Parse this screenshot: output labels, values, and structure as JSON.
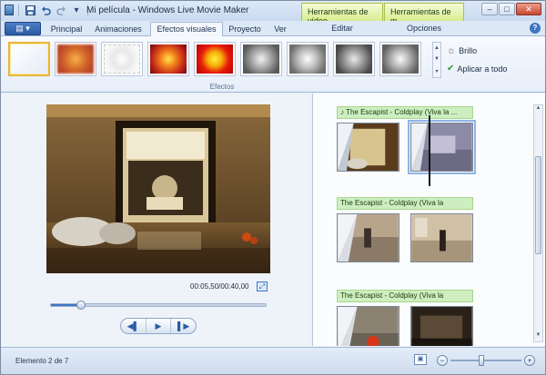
{
  "window": {
    "title": "Mi película - Windows Live Movie Maker",
    "contextual_tabs": [
      "Herramientas de vídeo",
      "Herramientas de m..."
    ],
    "buttons": {
      "minimize": "–",
      "maximize": "□",
      "close": "✕"
    }
  },
  "quick_access": {
    "save_icon": "save-icon",
    "undo_icon": "undo-icon",
    "redo_icon": "redo-icon",
    "more_icon": "dropdown-icon"
  },
  "tabs": {
    "app_menu": "▤ ▾",
    "items": [
      "Principal",
      "Animaciones",
      "Efectos visuales",
      "Proyecto",
      "Ver"
    ],
    "active": "Efectos visuales",
    "context": [
      "Editar",
      "Opciones"
    ],
    "help": "?"
  },
  "ribbon": {
    "effects_count": 9,
    "brightness_label": "Brillo",
    "apply_all_label": "Aplicar a todo",
    "group_label": "Efectos",
    "colors": {
      "selected_border": "#e8b53a",
      "selected_fill": "#fdeaa5"
    }
  },
  "preview": {
    "timecode": "00:05,50/00:40,00",
    "seek_progress": 0.14,
    "controls": {
      "prev": "◀▌",
      "play": "▶",
      "next": "▌▶"
    }
  },
  "storyboard": {
    "music_label": "The Escapist - Coldplay (Viva la ...",
    "music_label_short": "The Escapist - Coldplay (Viva la",
    "clips": 3
  },
  "status": {
    "text": "Elemento 2 de 7",
    "zoom_out": "−",
    "zoom_in": "+",
    "zoom_level": 0.4
  }
}
